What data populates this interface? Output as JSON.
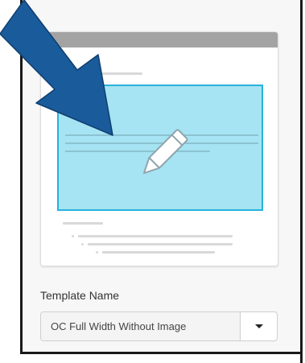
{
  "template": {
    "label": "Template Name",
    "selected_value": "OC Full Width Without Image"
  },
  "icons": {
    "hero_icon": "pencil-icon",
    "dropdown_icon": "caret-down-icon",
    "annotation": "arrow-icon"
  },
  "colors": {
    "hero_fill": "#a6e3f3",
    "hero_border": "#27b3dc",
    "annotation_arrow": "#1a5b9c",
    "card_header": "#a3a3a3"
  }
}
